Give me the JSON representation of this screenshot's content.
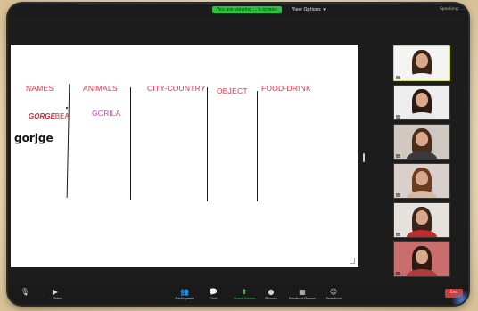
{
  "topbar": {
    "share_banner": "You are viewing ...'s screen",
    "view_options": "View Options",
    "view_options_chevron": "chevron-down-icon",
    "speaking": "Speaking: ..."
  },
  "whiteboard": {
    "headers": [
      "NAMES",
      "ANIMALS",
      "CITY-COUNTRY",
      "OBJECT",
      "FOOD-DRINK"
    ],
    "entries": {
      "name_red": "GORGE",
      "name_red_tail": "BEA",
      "animal_pink": "GORILA",
      "handwritten": "gorjge"
    },
    "colors": {
      "header": "#e5304a",
      "animal": "#d93ecf",
      "line": "#1a1a1a"
    }
  },
  "gallery": {
    "tiles": [
      {
        "name": "...",
        "active": true,
        "hair": "#3a2418",
        "shirt": "#f2f2f2",
        "bg": "#f4f4f2"
      },
      {
        "name": "...",
        "active": false,
        "hair": "#2a1a12",
        "shirt": "#e8e8e8",
        "bg": "#eeeeee"
      },
      {
        "name": "...",
        "active": false,
        "hair": "#4a2c1c",
        "shirt": "#3a3a3a",
        "bg": "#cfc8c0"
      },
      {
        "name": "...",
        "active": false,
        "hair": "#6b3b22",
        "shirt": "#d8b8a0",
        "bg": "#d9cfcb"
      },
      {
        "name": "...",
        "active": false,
        "hair": "#3a241a",
        "shirt": "#c02a2a",
        "bg": "#e6e1dc"
      },
      {
        "name": "...",
        "active": false,
        "hair": "#2a1a12",
        "shirt": "#b33a3a",
        "bg": "#c96d6d"
      }
    ]
  },
  "toolbar": {
    "items": [
      {
        "label": "...",
        "icon": "microphone-icon"
      },
      {
        "label": "... Video",
        "icon": "video-camera-icon"
      },
      {
        "label": "Participants",
        "icon": "participants-icon"
      },
      {
        "label": "Chat",
        "icon": "chat-icon"
      },
      {
        "label": "Share Screen",
        "icon": "share-screen-icon"
      },
      {
        "label": "Record",
        "icon": "record-icon"
      },
      {
        "label": "Breakout Rooms",
        "icon": "breakout-rooms-icon"
      },
      {
        "label": "Reactions",
        "icon": "reactions-icon"
      }
    ],
    "end_button": "End"
  }
}
